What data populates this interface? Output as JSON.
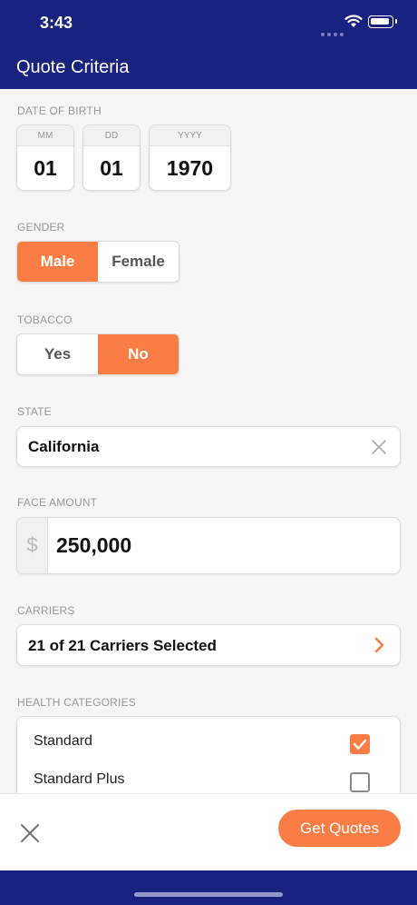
{
  "status_bar": {
    "time": "3:43"
  },
  "nav": {
    "title": "Quote Criteria"
  },
  "date_of_birth": {
    "label": "DATE OF BIRTH",
    "month": {
      "header": "MM",
      "value": "01"
    },
    "day": {
      "header": "DD",
      "value": "01"
    },
    "year": {
      "header": "YYYY",
      "value": "1970"
    }
  },
  "gender": {
    "label": "GENDER",
    "options": [
      "Male",
      "Female"
    ],
    "selected": "Male"
  },
  "tobacco": {
    "label": "TOBACCO",
    "options": [
      "Yes",
      "No"
    ],
    "selected": "No"
  },
  "state": {
    "label": "STATE",
    "value": "California"
  },
  "face_amount": {
    "label": "FACE AMOUNT",
    "currency_symbol": "$",
    "value": "250,000"
  },
  "carriers": {
    "label": "CARRIERS",
    "value": "21 of 21 Carriers Selected"
  },
  "health_categories": {
    "label": "HEALTH CATEGORIES",
    "items": [
      {
        "name": "Standard",
        "checked": true
      },
      {
        "name": "Standard Plus",
        "checked": false
      }
    ]
  },
  "actions": {
    "get_quotes": "Get Quotes"
  },
  "colors": {
    "navy": "#1a2280",
    "accent": "#fa7d45"
  }
}
